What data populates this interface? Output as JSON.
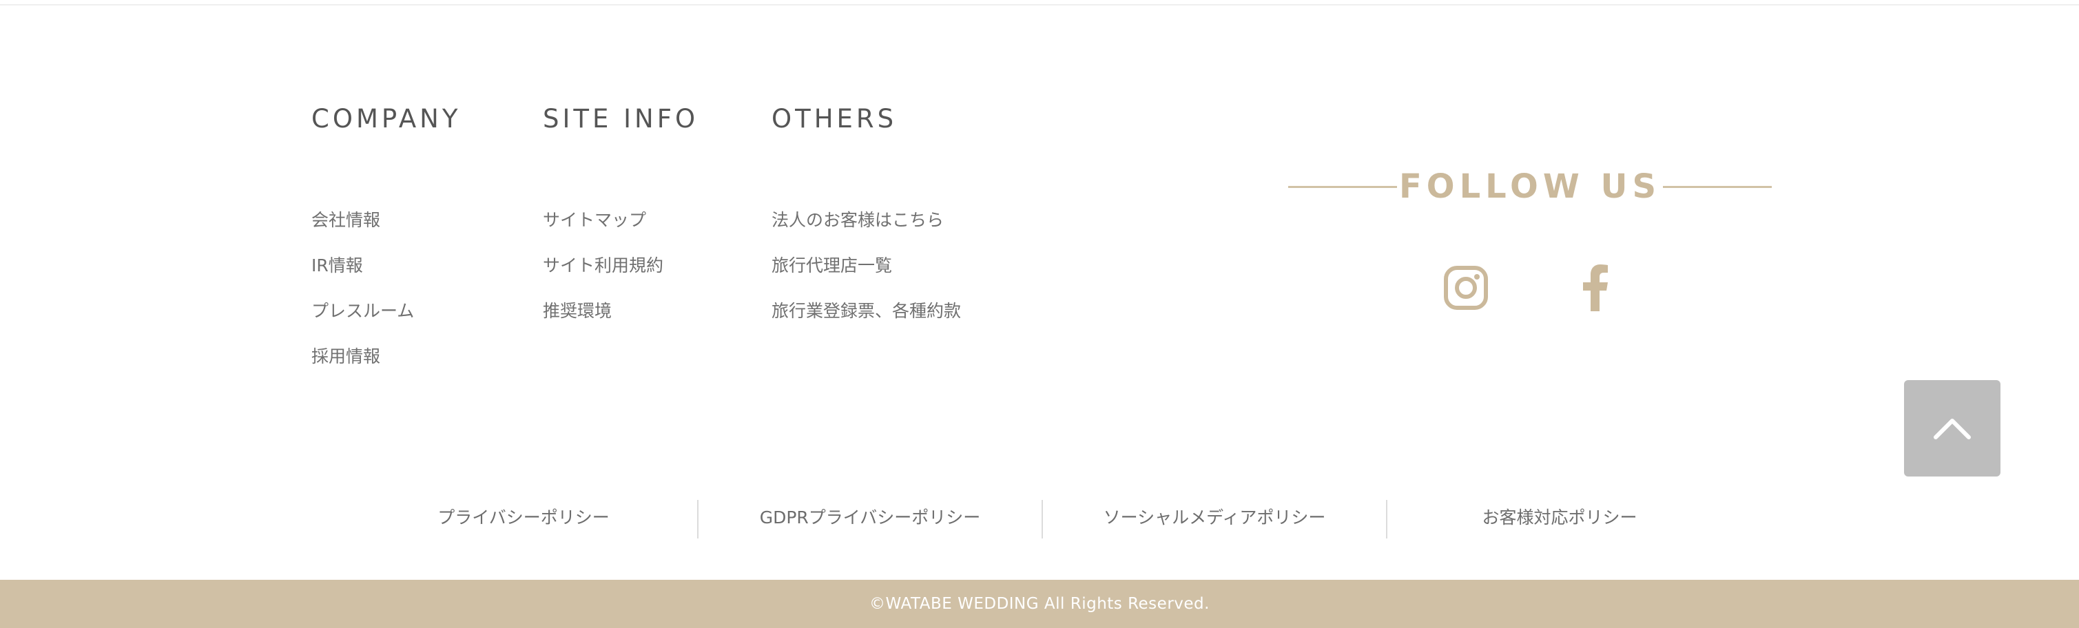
{
  "footer": {
    "columns": [
      {
        "heading": "COMPANY",
        "links": [
          "会社情報",
          "IR情報",
          "プレスルーム",
          "採用情報"
        ]
      },
      {
        "heading": "SITE INFO",
        "links": [
          "サイトマップ",
          "サイト利用規約",
          "推奨環境"
        ]
      },
      {
        "heading": "OTHERS",
        "links": [
          "法人のお客様はこちら",
          "旅行代理店一覧",
          "旅行業登録票、各種約款"
        ]
      }
    ],
    "follow_title": "FOLLOW US",
    "social": [
      "instagram-icon",
      "facebook-icon"
    ],
    "policies": [
      "プライバシーポリシー",
      "GDPRプライバシーポリシー",
      "ソーシャルメディアポリシー",
      "お客様対応ポリシー"
    ],
    "copyright": "©WATABE WEDDING All Rights Reserved."
  },
  "colors": {
    "accent": "#cbb99b",
    "footer_bar": "#d0c0a5",
    "back_to_top": "#bdbdbd"
  }
}
